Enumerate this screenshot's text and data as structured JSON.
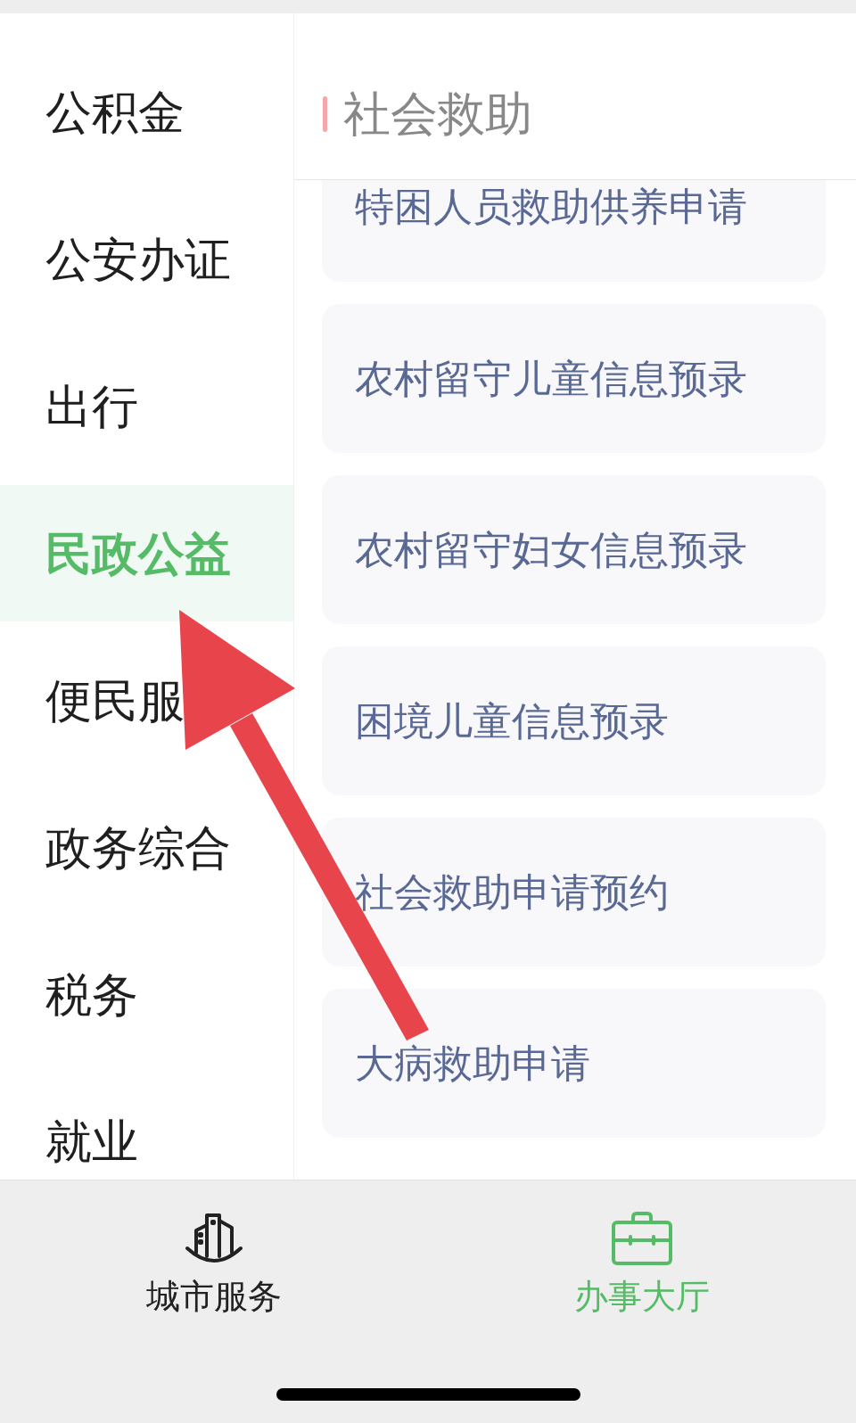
{
  "sidebar": {
    "items": [
      {
        "label": "公积金",
        "selected": false,
        "partly_hidden": false
      },
      {
        "label": "公安办证",
        "selected": false,
        "partly_hidden": false
      },
      {
        "label": "出行",
        "selected": false,
        "partly_hidden": false
      },
      {
        "label": "民政公益",
        "selected": true,
        "partly_hidden": false
      },
      {
        "label": "便民服",
        "selected": false,
        "partly_hidden": false
      },
      {
        "label": "政务综合",
        "selected": false,
        "partly_hidden": false
      },
      {
        "label": "税务",
        "selected": false,
        "partly_hidden": false
      },
      {
        "label": "就业",
        "selected": false,
        "partly_hidden": true
      }
    ]
  },
  "section": {
    "title": "社会救助"
  },
  "services": [
    {
      "label": "特困人员救助供养申请",
      "partly_hidden": true
    },
    {
      "label": "农村留守儿童信息预录",
      "partly_hidden": false
    },
    {
      "label": "农村留守妇女信息预录",
      "partly_hidden": false
    },
    {
      "label": "困境儿童信息预录",
      "partly_hidden": false
    },
    {
      "label": "社会救助申请预约",
      "partly_hidden": false
    },
    {
      "label": "大病救助申请",
      "partly_hidden": false
    }
  ],
  "tab_bar": {
    "tabs": [
      {
        "label": "城市服务",
        "selected": false
      },
      {
        "label": "办事大厅",
        "selected": true
      }
    ]
  }
}
